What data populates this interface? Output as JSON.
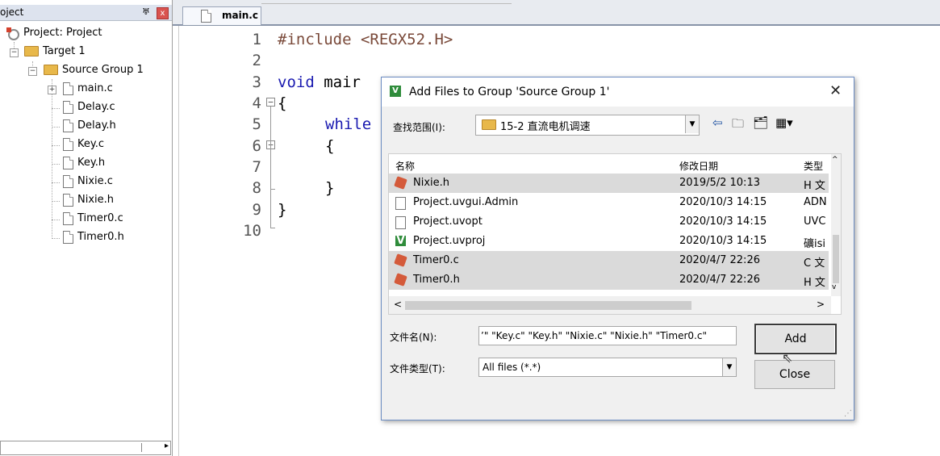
{
  "project_pane": {
    "title": "oject",
    "pin": "♅",
    "close": "x",
    "tree": [
      {
        "label": "Project: Project"
      },
      {
        "label": "Target 1"
      },
      {
        "label": "Source Group 1"
      },
      {
        "label": "main.c"
      },
      {
        "label": "Delay.c"
      },
      {
        "label": "Delay.h"
      },
      {
        "label": "Key.c"
      },
      {
        "label": "Key.h"
      },
      {
        "label": "Nixie.c"
      },
      {
        "label": "Nixie.h"
      },
      {
        "label": "Timer0.c"
      },
      {
        "label": "Timer0.h"
      }
    ]
  },
  "editor": {
    "tab": "main.c",
    "line_numbers": [
      "1",
      "2",
      "3",
      "4",
      "5",
      "6",
      "7",
      "8",
      "9",
      "10"
    ],
    "code": {
      "l1_pp": "#include",
      "l1_rest": " <REGX52.H>",
      "l3_kw": "void",
      "l3_rest": " mair",
      "l4": "{",
      "l5_kw": "while",
      "l6": "{",
      "l8": "}",
      "l9": "}"
    }
  },
  "dialog": {
    "title": "Add Files to Group 'Source Group 1'",
    "close": "✕",
    "look_in_label": "查找范围(I):",
    "look_in_value": "15-2 直流电机调速",
    "toolbar": {
      "back": "⇦",
      "up": "🗀",
      "new_folder": "🗂",
      "view": "▦▾"
    },
    "columns": {
      "name": "名称",
      "date": "修改日期",
      "type": "类型"
    },
    "files": [
      {
        "name": "Nixie.h",
        "date": "2019/5/2 10:13",
        "type": "H 文",
        "icon": "c-source-icon",
        "selected": true
      },
      {
        "name": "Project.uvgui.Admin",
        "date": "2020/10/3 14:15",
        "type": "ADN",
        "icon": "file-icon",
        "selected": false
      },
      {
        "name": "Project.uvopt",
        "date": "2020/10/3 14:15",
        "type": "UVC",
        "icon": "file-icon",
        "selected": false
      },
      {
        "name": "Project.uvproj",
        "date": "2020/10/3 14:15",
        "type": "礦isi",
        "icon": "uvision-icon",
        "selected": false
      },
      {
        "name": "Timer0.c",
        "date": "2020/4/7 22:26",
        "type": "C 文",
        "icon": "c-source-icon",
        "selected": true
      },
      {
        "name": "Timer0.h",
        "date": "2020/4/7 22:26",
        "type": "H 文",
        "icon": "c-source-icon",
        "selected": true
      }
    ],
    "filename_label": "文件名(N):",
    "filename_value": "’\" \"Key.c\" \"Key.h\" \"Nixie.c\" \"Nixie.h\" \"Timer0.c\"",
    "filetype_label": "文件类型(T):",
    "filetype_value": "All files (*.*)",
    "add_label": "Add",
    "close_label": "Close"
  }
}
